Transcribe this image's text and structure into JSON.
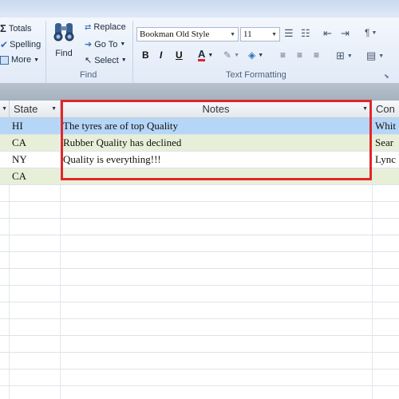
{
  "ribbon": {
    "editing": {
      "totals": "Totals",
      "spelling": "Spelling",
      "more": "More",
      "find": "Find",
      "replace": "Replace",
      "goto": "Go To",
      "select": "Select"
    },
    "group_find": "Find",
    "group_text": "Text Formatting",
    "font_name": "Bookman Old Style",
    "font_size": "11",
    "bold": "B",
    "italic": "I",
    "underline": "U",
    "font_color_glyph": "A",
    "accent_color": "#e0262b"
  },
  "table": {
    "headers": {
      "state": "State",
      "notes": "Notes",
      "next": "Con"
    },
    "rows": [
      {
        "state": "HI",
        "notes": "The tyres are of top Quality",
        "next": "Whit"
      },
      {
        "state": "CA",
        "notes": "Rubber Quality has declined",
        "next": "Sear"
      },
      {
        "state": "NY",
        "notes": "Quality is everything!!!",
        "next": "Lync"
      },
      {
        "state": "CA",
        "notes": "",
        "next": ""
      }
    ]
  },
  "colors": {
    "selected_row": "#b6d6f7",
    "alt_row": "#e7efd9",
    "highlight_border": "#e0262b"
  }
}
